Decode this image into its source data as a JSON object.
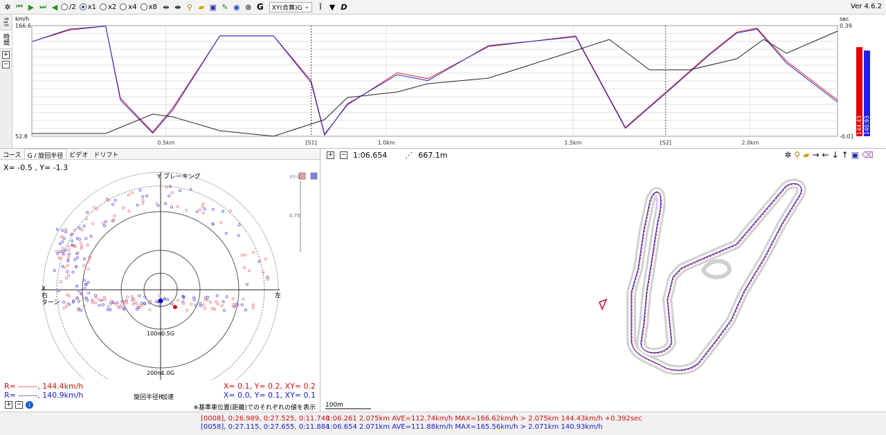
{
  "toolbar": {
    "radios": [
      {
        "label": "/2",
        "selected": false
      },
      {
        "label": "x1",
        "selected": true
      },
      {
        "label": "x2",
        "selected": false
      },
      {
        "label": "x4",
        "selected": false
      },
      {
        "label": "x8",
        "selected": false
      }
    ],
    "g_label": "G",
    "mode_select": "XY(合算)G",
    "version": "Ver 4.6.2"
  },
  "side_tabs": [
    "ｷｮﾘ",
    "時間"
  ],
  "chart_data": {
    "type": "line",
    "y_unit_left": "km/h",
    "y_unit_right": "sec",
    "ylim_left": [
      52.8,
      166.6
    ],
    "ylim_right": [
      -0.01,
      0.39
    ],
    "y_ticks_left": [
      "166.6",
      "52.8"
    ],
    "y_ticks_right": [
      "0.39",
      "-0.01"
    ],
    "x_ticks": [
      "0.5km",
      "[S1]",
      "1.0km",
      "1.5km",
      "[S2]",
      "2.0km"
    ],
    "series": [
      {
        "name": "red",
        "color": "#e02020",
        "x": [
          0,
          0.28,
          0.55,
          0.66,
          0.9,
          1.05,
          1.4,
          1.8,
          2.08,
          2.18,
          2.35,
          2.72,
          2.95,
          3.4,
          4.05,
          4.42,
          4.72,
          5.05,
          5.25,
          5.4,
          5.62,
          6.0
        ],
        "y": [
          150,
          162,
          166,
          92,
          57,
          82,
          156,
          156,
          110,
          55,
          85,
          118,
          112,
          145,
          156,
          62,
          98,
          138,
          160,
          164,
          130,
          90
        ]
      },
      {
        "name": "blue",
        "color": "#2020d0",
        "x": [
          0,
          0.28,
          0.55,
          0.66,
          0.9,
          1.05,
          1.4,
          1.8,
          2.08,
          2.18,
          2.35,
          2.72,
          2.95,
          3.4,
          4.05,
          4.42,
          4.72,
          5.05,
          5.25,
          5.4,
          5.62,
          6.0
        ],
        "y": [
          150,
          163,
          166,
          90,
          56,
          80,
          156,
          156,
          108,
          54,
          86,
          116,
          110,
          146,
          155,
          61,
          97,
          137,
          159,
          163,
          128,
          88
        ]
      },
      {
        "name": "diff",
        "color": "#222222",
        "x": [
          0,
          0.55,
          0.9,
          1.05,
          1.4,
          1.8,
          2.18,
          2.35,
          2.72,
          2.95,
          3.4,
          4.05,
          4.3,
          4.6,
          4.9,
          5.25,
          5.45,
          5.62,
          6.0
        ],
        "y": [
          0.0,
          0.0,
          0.07,
          0.06,
          0.01,
          -0.01,
          0.05,
          0.13,
          0.15,
          0.18,
          0.2,
          0.3,
          0.34,
          0.23,
          0.23,
          0.27,
          0.34,
          0.29,
          0.37
        ]
      }
    ],
    "bars": [
      {
        "label": "144.43",
        "value": 144.43,
        "color": "#e00000"
      },
      {
        "label": "140.93",
        "value": 140.93,
        "color": "#2020e0"
      }
    ]
  },
  "gpanel": {
    "tabs": [
      "コース",
      "G / 旋回半径",
      "ビデオ",
      "ドリフト"
    ],
    "readout": "X= -0.5 , Y= -1.3",
    "labels": {
      "top": "Y",
      "braking": "ブレーキング",
      "left_x": "X",
      "right_turn": "右\nターン",
      "left_side": "左",
      "xy_g": "XY-G",
      "scale_075": "0.75",
      "r100": "100m",
      "g05": "0.5G",
      "r200": "200m",
      "g10": "1.0G",
      "bottom": "旋回半径R",
      "accel": "加速"
    },
    "stats": {
      "red_r": "R= -------, 144.4km/h",
      "blue_r": "R= -------, 140.9km/h",
      "red_xy": "X=  0.1, Y=  0.2, XY= 0.2",
      "blue_xy": "X=  0.0, Y=  0.1, XY= 0.1"
    },
    "note": "※基準車位置(距離)でのそれぞれの値を表示"
  },
  "map": {
    "time": "1:06.654",
    "distance": "667.1m",
    "scale": "100m"
  },
  "footer": {
    "sectors_red": "[0008], 0:26.989, 0:27.525, 0:11.748",
    "sectors_blue": "[0058], 0:27.115, 0:27.655, 0:11.884",
    "lap_red": "1:06.261  2.075km  AVE=112.74km/h  MAX=166.62km/h > 2.075km  144.43km/h  +0.392sec",
    "lap_blue": "1:06.654  2.071km  AVE=111.88km/h  MAX=165.56km/h > 2.071km  140.93km/h",
    "colors": {
      "red": "#d01010",
      "blue": "#1a1ac8"
    }
  }
}
